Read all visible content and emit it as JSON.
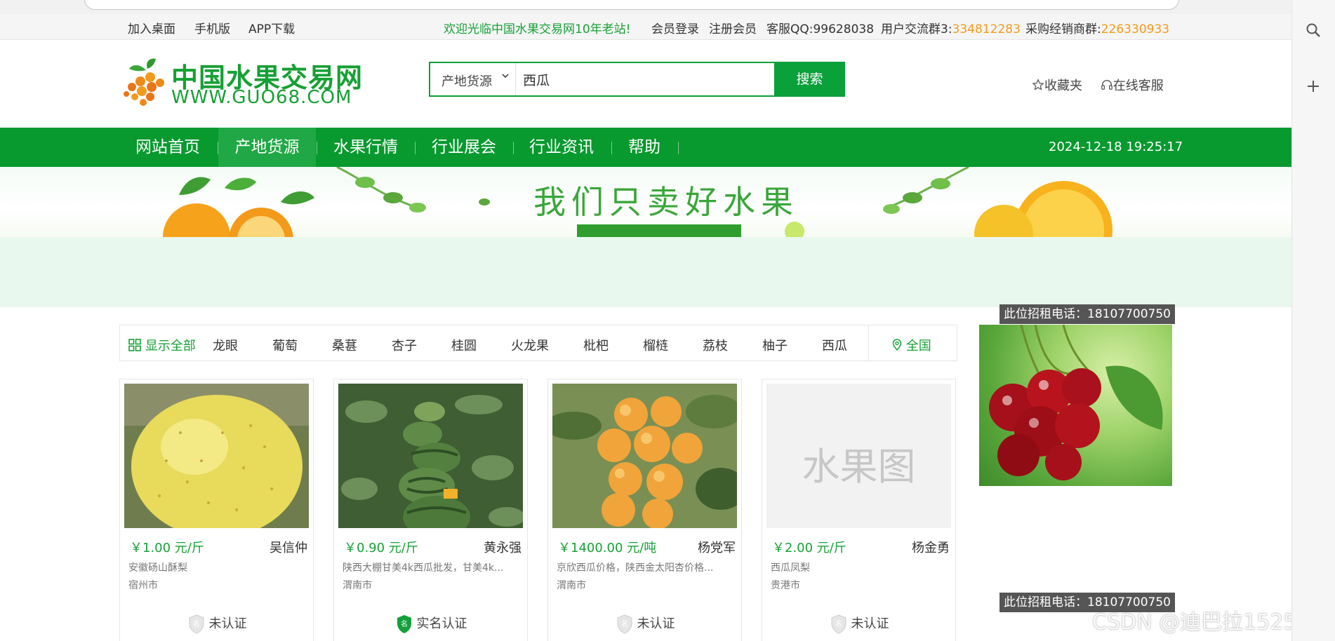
{
  "topbar": {
    "add_desktop": "加入桌面",
    "mobile": "手机版",
    "app_download": "APP下载",
    "welcome": "欢迎光临中国水果交易网10年老站!",
    "login": "会员登录",
    "register": "注册会员",
    "service_qq": "客服QQ:99628038",
    "user_group_label": "用户交流群3:",
    "user_group_num": "334812283",
    "buyer_group_label": "采购经销商群:",
    "buyer_group_num": "226330933"
  },
  "logo": {
    "cn": "中国水果交易网",
    "en": "WWW.GUO68.COM"
  },
  "search": {
    "category": "产地货源",
    "value": "西瓜",
    "button": "搜索"
  },
  "header_links": {
    "favorites": "收藏夹",
    "online_service": "在线客服"
  },
  "nav": {
    "items": [
      "网站首页",
      "产地货源",
      "水果行情",
      "行业展会",
      "行业资讯",
      "帮助"
    ],
    "active_index": 1,
    "datetime": "2024-12-18 19:25:17"
  },
  "banner": {
    "slogan": "我们只卖好水果",
    "ad_tag": "此位招租电话：18107700750"
  },
  "filter": {
    "show_all": "显示全部",
    "categories": [
      "龙眼",
      "葡萄",
      "桑葚",
      "杏子",
      "桂圆",
      "火龙果",
      "枇杷",
      "榴梿",
      "荔枝",
      "柚子",
      "西瓜"
    ],
    "region": "全国"
  },
  "side_ad_tag": "此位招租电话：18107700750",
  "products": [
    {
      "price": "￥1.00 元/斤",
      "seller": "吴信仲",
      "title": "安徽砀山酥梨",
      "city": "宿州市",
      "cert": "未认证",
      "verified": false
    },
    {
      "price": "￥0.90 元/斤",
      "seller": "黄永强",
      "title": "陕西大棚甘美4k西瓜批发，甘美4k...",
      "city": "渭南市",
      "cert": "实名认证",
      "verified": true
    },
    {
      "price": "￥1400.00 元/吨",
      "seller": "杨党军",
      "title": "京欣西瓜价格，陕西金太阳杏价格...",
      "city": "渭南市",
      "cert": "未认证",
      "verified": false
    },
    {
      "price": "￥2.00 元/斤",
      "seller": "杨金勇",
      "title": "西瓜凤梨",
      "city": "贵港市",
      "cert": "未认证",
      "verified": false
    }
  ],
  "placeholder_image_text": "水果图",
  "watermark": "CSDN @迪巴拉1525",
  "colors": {
    "brand_green": "#08992f",
    "accent_orange": "#f39a1a"
  }
}
